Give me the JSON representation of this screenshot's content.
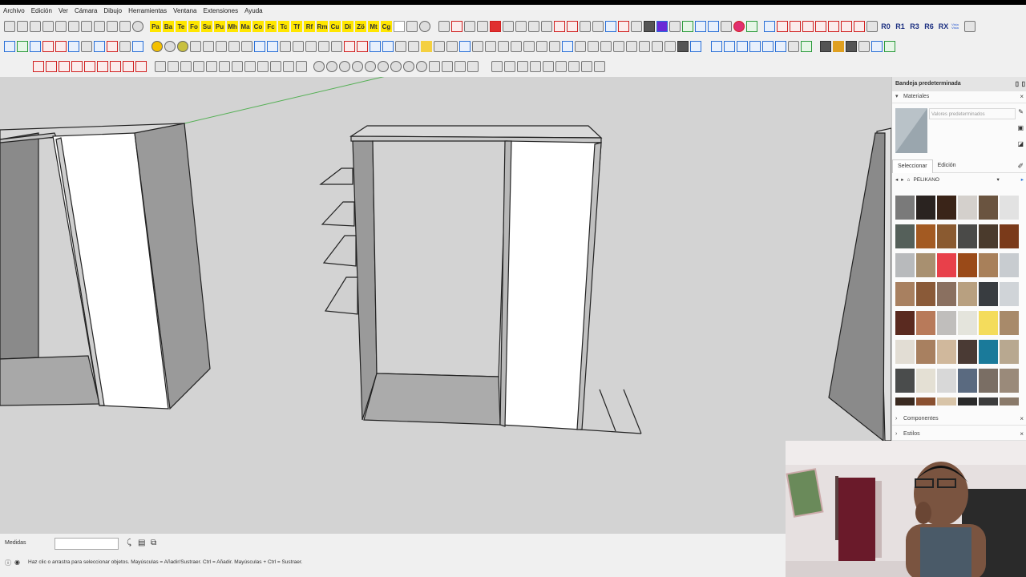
{
  "menu": [
    "Archivo",
    "Edición",
    "Ver",
    "Cámara",
    "Dibujo",
    "Herramientas",
    "Ventana",
    "Extensiones",
    "Ayuda"
  ],
  "toolbar_labels": {
    "yellow": [
      "Pa",
      "Ba",
      "Te",
      "Fo",
      "Su",
      "Pu",
      "Mh",
      "Ma",
      "Co",
      "Fc",
      "Tc",
      "Tf",
      "Rf",
      "Rm",
      "Cu",
      "Di",
      "Zö",
      "Mt",
      "Cg"
    ],
    "rotations": [
      "R0",
      "R1",
      "R3",
      "R6",
      "RX"
    ],
    "vista": "Vista Vista"
  },
  "tray": {
    "title": "Bandeja predeterminada",
    "materials_section": "Materiales",
    "name_placeholder": "Valores predeterminados",
    "tabs": [
      "Seleccionar",
      "Edición"
    ],
    "library": "PELIKANO",
    "components_section": "Componentes",
    "styles_section": "Estilos"
  },
  "swatch_colors": [
    "#7a7a7a",
    "#2a2320",
    "#3a2418",
    "#d4d0cc",
    "#6a5440",
    "#e2e2e2",
    "#55605a",
    "#a35a22",
    "#8a5a30",
    "#4a4a48",
    "#4a3a2c",
    "#7a3a1a",
    "#b8babc",
    "#a89070",
    "#e8404a",
    "#9a4a18",
    "#a8805a",
    "#c8ccd0",
    "#a88060",
    "#8a5a38",
    "#8a7060",
    "#b8a080",
    "#383c40",
    "#d0d4d8",
    "#5a2a20",
    "#b87a5a",
    "#c0bebc",
    "#e4e4dc",
    "#f4dc5c",
    "#a88a6a",
    "#e2ddd4",
    "#a88060",
    "#d0b89c",
    "#4a3a34",
    "#1a7a9a",
    "#b8a890",
    "#4a4c4c",
    "#e4e0d4",
    "#d8d8d8",
    "#5a6a80",
    "#7a6e64",
    "#9a8a7a",
    "#3a2a20",
    "#8a5030",
    "#d8c4a8",
    "#2a2a2a",
    "#3c3c3c",
    "#8a7a6a"
  ],
  "status": {
    "measure_label": "Medidas",
    "hint": "Haz clic o arrastra para seleccionar objetos. Mayúsculas = Añadir/Sustraer. Ctrl = Añadir. Mayúsculas + Ctrl = Sustraer."
  }
}
